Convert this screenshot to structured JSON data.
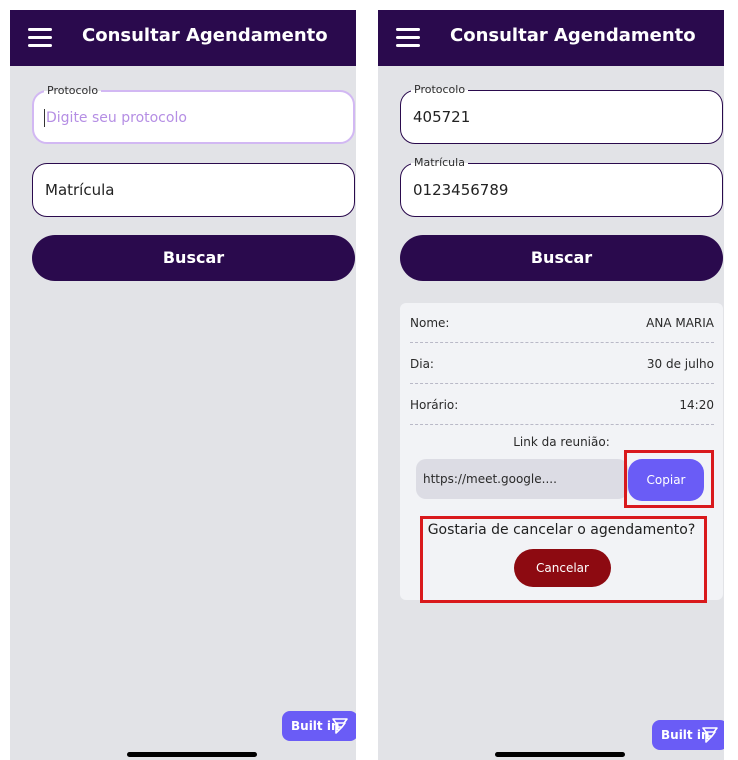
{
  "app": {
    "title": "Consultar Agendamento",
    "menu_icon": "hamburger-menu-icon",
    "primary_color": "#2a0a4d",
    "accent_color": "#6a5cf6",
    "danger_color": "#8d0a11"
  },
  "left_screen": {
    "protocolo": {
      "label": "Protocolo",
      "placeholder": "Digite seu protocolo",
      "value": ""
    },
    "matricula": {
      "placeholder": "Matrícula",
      "value": ""
    },
    "search_button": "Buscar",
    "badge": {
      "label": "Built in",
      "icon": "builder-logo-icon"
    }
  },
  "right_screen": {
    "protocolo": {
      "label": "Protocolo",
      "value": "405721"
    },
    "matricula": {
      "label": "Matrícula",
      "value": "0123456789"
    },
    "search_button": "Buscar",
    "result": {
      "rows": [
        {
          "key": "Nome:",
          "value": "ANA MARIA"
        },
        {
          "key": "Dia:",
          "value": "30 de julho"
        },
        {
          "key": "Horário:",
          "value": "14:20"
        }
      ],
      "link_label": "Link da reunião:",
      "link_value": "https://meet.google....",
      "copy_button": "Copiar",
      "cancel_question": "Gostaria de cancelar o agendamento?",
      "cancel_button": "Cancelar",
      "highlight_color": "#d9191c"
    },
    "badge": {
      "label": "Built in",
      "icon": "builder-logo-icon"
    }
  }
}
